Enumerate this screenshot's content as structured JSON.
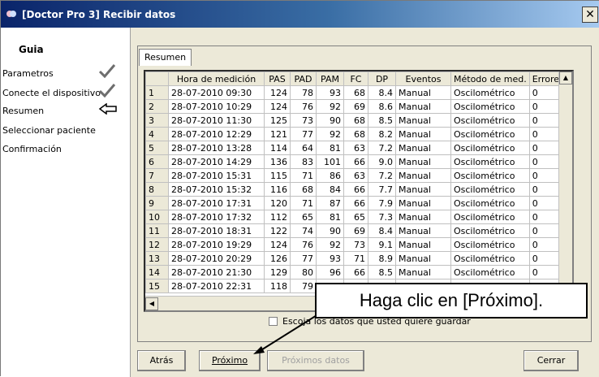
{
  "window": {
    "title": "[Doctor Pro 3] Recibir datos"
  },
  "sidebar": {
    "heading": "Guia",
    "steps": [
      {
        "label": "Parametros",
        "status": "checked"
      },
      {
        "label": "Conecte el dispositivo",
        "status": "checked"
      },
      {
        "label": "Resumen",
        "status": "current"
      },
      {
        "label": "Seleccionar paciente",
        "status": ""
      },
      {
        "label": "Confirmación",
        "status": ""
      }
    ]
  },
  "tab": {
    "label": "Resumen"
  },
  "table": {
    "columns": [
      "",
      "Hora de medición",
      "PAS",
      "PAD",
      "PAM",
      "FC",
      "DP",
      "Eventos",
      "Método de med.",
      "Errores"
    ],
    "rows": [
      [
        "1",
        "28-07-2010 09:30",
        "124",
        "78",
        "93",
        "68",
        "8.4",
        "Manual",
        "Oscilométrico",
        "0"
      ],
      [
        "2",
        "28-07-2010 10:29",
        "124",
        "76",
        "92",
        "69",
        "8.6",
        "Manual",
        "Oscilométrico",
        "0"
      ],
      [
        "3",
        "28-07-2010 11:30",
        "125",
        "73",
        "90",
        "68",
        "8.5",
        "Manual",
        "Oscilométrico",
        "0"
      ],
      [
        "4",
        "28-07-2010 12:29",
        "121",
        "77",
        "92",
        "68",
        "8.2",
        "Manual",
        "Oscilométrico",
        "0"
      ],
      [
        "5",
        "28-07-2010 13:28",
        "114",
        "64",
        "81",
        "63",
        "7.2",
        "Manual",
        "Oscilométrico",
        "0"
      ],
      [
        "6",
        "28-07-2010 14:29",
        "136",
        "83",
        "101",
        "66",
        "9.0",
        "Manual",
        "Oscilométrico",
        "0"
      ],
      [
        "7",
        "28-07-2010 15:31",
        "115",
        "71",
        "86",
        "63",
        "7.2",
        "Manual",
        "Oscilométrico",
        "0"
      ],
      [
        "8",
        "28-07-2010 15:32",
        "116",
        "68",
        "84",
        "66",
        "7.7",
        "Manual",
        "Oscilométrico",
        "0"
      ],
      [
        "9",
        "28-07-2010 17:31",
        "120",
        "71",
        "87",
        "66",
        "7.9",
        "Manual",
        "Oscilométrico",
        "0"
      ],
      [
        "10",
        "28-07-2010 17:32",
        "112",
        "65",
        "81",
        "65",
        "7.3",
        "Manual",
        "Oscilométrico",
        "0"
      ],
      [
        "11",
        "28-07-2010 18:31",
        "122",
        "74",
        "90",
        "69",
        "8.4",
        "Manual",
        "Oscilométrico",
        "0"
      ],
      [
        "12",
        "28-07-2010 19:29",
        "124",
        "76",
        "92",
        "73",
        "9.1",
        "Manual",
        "Oscilométrico",
        "0"
      ],
      [
        "13",
        "28-07-2010 20:29",
        "126",
        "77",
        "93",
        "71",
        "8.9",
        "Manual",
        "Oscilométrico",
        "0"
      ],
      [
        "14",
        "28-07-2010 21:30",
        "129",
        "80",
        "96",
        "66",
        "8.5",
        "Manual",
        "Oscilométrico",
        "0"
      ],
      [
        "15",
        "28-07-2010 22:31",
        "118",
        "79",
        "",
        "",
        "",
        "",
        "",
        ""
      ]
    ]
  },
  "checkbox": {
    "label": "Escoja los datos que usted quiere guardar"
  },
  "buttons": {
    "back": "Atrás",
    "next": "Próximo",
    "next_data": "Próximos datos",
    "close": "Cerrar"
  },
  "callout": {
    "text": "Haga clic en [Próximo]."
  },
  "colors": {
    "check": "#6e6e6e",
    "arrow": "#000000"
  }
}
